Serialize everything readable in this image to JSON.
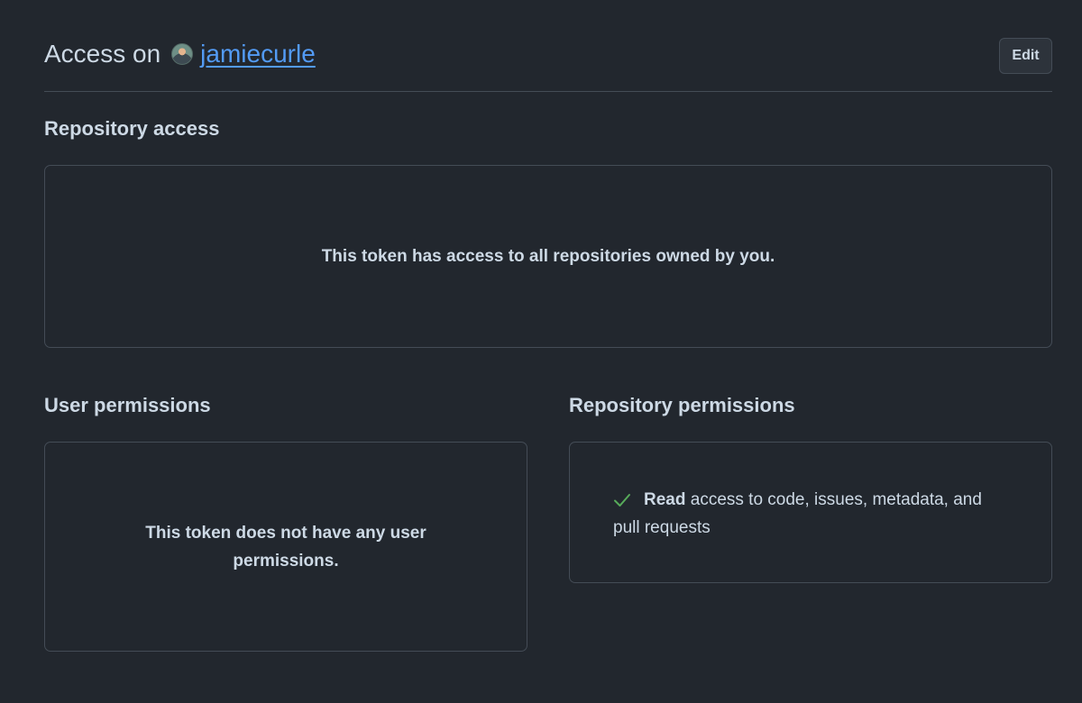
{
  "header": {
    "prefix": "Access on",
    "username": "jamiecurle",
    "edit_label": "Edit"
  },
  "repository_access": {
    "title": "Repository access",
    "message": "This token has access to all repositories owned by you."
  },
  "user_permissions": {
    "title": "User permissions",
    "message": "This token does not have any user permissions."
  },
  "repository_permissions": {
    "title": "Repository permissions",
    "items": [
      {
        "level": "Read",
        "description": "access to code, issues, metadata, and pull requests",
        "icon": "check-icon"
      }
    ]
  }
}
